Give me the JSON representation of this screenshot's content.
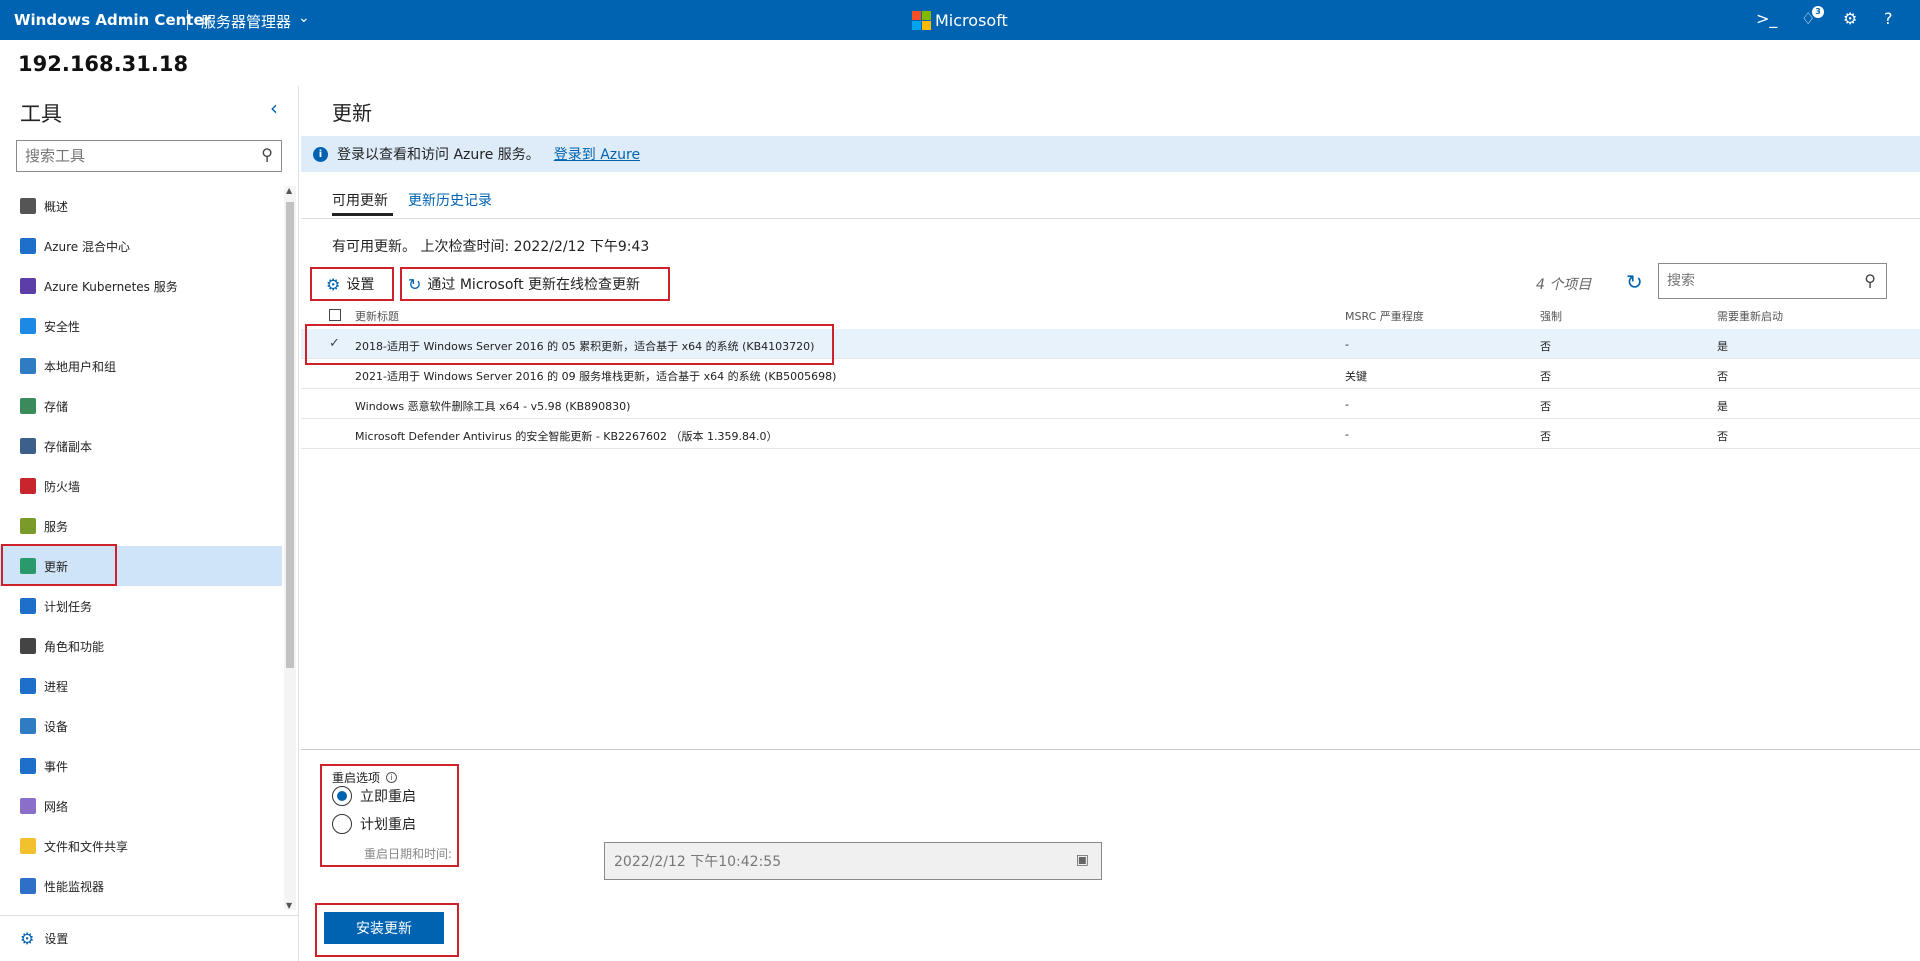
{
  "topbar": {
    "brand": "Windows Admin Center",
    "server_manager": "服务器管理器",
    "microsoft": "Microsoft",
    "notification_count": "3",
    "colors": {
      "bar": "#0063b1"
    }
  },
  "server_ip": "192.168.31.18",
  "sidebar": {
    "title": "工具",
    "search_placeholder": "搜索工具",
    "items": [
      {
        "label": "概述",
        "icon": "overview-icon",
        "color": "#555"
      },
      {
        "label": "Azure 混合中心",
        "icon": "azure-cloud-icon",
        "color": "#1e6fc8"
      },
      {
        "label": "Azure Kubernetes 服务",
        "icon": "kubernetes-icon",
        "color": "#5b3ea8"
      },
      {
        "label": "安全性",
        "icon": "shield-icon",
        "color": "#1e88e5"
      },
      {
        "label": "本地用户和组",
        "icon": "users-icon",
        "color": "#2f7cc2"
      },
      {
        "label": "存储",
        "icon": "storage-icon",
        "color": "#3a8a5c"
      },
      {
        "label": "存储副本",
        "icon": "storage-replica-icon",
        "color": "#3c5f8c"
      },
      {
        "label": "防火墙",
        "icon": "firewall-icon",
        "color": "#c8262c"
      },
      {
        "label": "服务",
        "icon": "services-icon",
        "color": "#7a9a2a"
      },
      {
        "label": "更新",
        "icon": "updates-icon",
        "color": "#2a9a6a"
      },
      {
        "label": "计划任务",
        "icon": "scheduled-tasks-icon",
        "color": "#1e6fc8"
      },
      {
        "label": "角色和功能",
        "icon": "roles-icon",
        "color": "#444"
      },
      {
        "label": "进程",
        "icon": "processes-icon",
        "color": "#1e6fc8"
      },
      {
        "label": "设备",
        "icon": "devices-icon",
        "color": "#2f7cc2"
      },
      {
        "label": "事件",
        "icon": "events-icon",
        "color": "#1e6fc8"
      },
      {
        "label": "网络",
        "icon": "network-icon",
        "color": "#8a6fc8"
      },
      {
        "label": "文件和文件共享",
        "icon": "folder-icon",
        "color": "#f2c12e"
      },
      {
        "label": "性能监视器",
        "icon": "performance-icon",
        "color": "#2f6fc8"
      }
    ],
    "selected_index": 9,
    "settings_label": "设置"
  },
  "main": {
    "title": "更新",
    "info_text": "登录以查看和访问 Azure 服务。",
    "info_link": "登录到 Azure",
    "tabs": [
      {
        "label": "可用更新"
      },
      {
        "label": "更新历史记录"
      }
    ],
    "status": "有可用更新。 上次检查时间: 2022/2/12 下午9:43",
    "toolbar": {
      "settings": "设置",
      "check_online": "通过 Microsoft 更新在线检查更新"
    },
    "count": "4 个项目",
    "search_placeholder": "搜索",
    "columns": [
      "更新标题",
      "MSRC 严重程度",
      "强制",
      "需要重新启动"
    ],
    "rows": [
      {
        "title": "2018-适用于 Windows Server 2016 的 05 累积更新，适合基于 x64 的系统 (KB4103720)",
        "severity": "-",
        "mandatory": "否",
        "reboot": "是"
      },
      {
        "title": "2021-适用于 Windows Server 2016 的 09 服务堆栈更新，适合基于 x64 的系统 (KB5005698)",
        "severity": "关键",
        "mandatory": "否",
        "reboot": "否"
      },
      {
        "title": "Windows 恶意软件删除工具 x64 - v5.98 (KB890830)",
        "severity": "-",
        "mandatory": "否",
        "reboot": "是"
      },
      {
        "title": "Microsoft Defender Antivirus 的安全智能更新 - KB2267602 （版本 1.359.84.0）",
        "severity": "-",
        "mandatory": "否",
        "reboot": "否"
      }
    ],
    "restart": {
      "label": "重启选项",
      "option_now": "立即重启",
      "option_schedule": "计划重启",
      "datetime_label": "重启日期和时间:",
      "datetime_value": "2022/2/12 下午10:42:55"
    },
    "install_button": "安装更新"
  }
}
